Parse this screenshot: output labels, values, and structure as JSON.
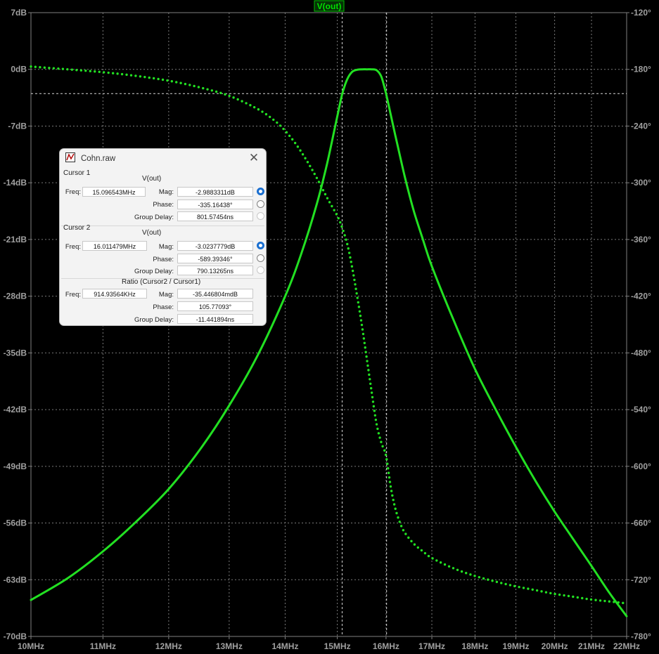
{
  "chart_data": {
    "type": "line",
    "title": "V(out)",
    "x_ticks": [
      "10MHz",
      "11MHz",
      "12MHz",
      "13MHz",
      "14MHz",
      "15MHz",
      "16MHz",
      "17MHz",
      "18MHz",
      "19MHz",
      "20MHz",
      "21MHz",
      "22MHz"
    ],
    "xlim": [
      10,
      22
    ],
    "x_scale": "log",
    "y_left_ticks": [
      "7dB",
      "0dB",
      "-7dB",
      "-14dB",
      "-21dB",
      "-28dB",
      "-35dB",
      "-42dB",
      "-49dB",
      "-56dB",
      "-63dB",
      "-70dB"
    ],
    "y_left_lim": [
      -70,
      7
    ],
    "y_right_ticks": [
      "-120°",
      "-180°",
      "-240°",
      "-300°",
      "-360°",
      "-420°",
      "-480°",
      "-540°",
      "-600°",
      "-660°",
      "-720°",
      "-780°"
    ],
    "y_right_lim": [
      -780,
      -120
    ],
    "grid": true,
    "cursor_x": [
      15.096543,
      16.011479
    ],
    "cursor_y_db": -2.99,
    "series": [
      {
        "name": "magnitude",
        "style": "solid",
        "axis": "left",
        "color": "#22e022",
        "x": [
          10.0,
          10.5,
          11.0,
          11.5,
          12.0,
          12.5,
          13.0,
          13.5,
          14.0,
          14.3,
          14.6,
          14.8,
          15.0,
          15.1,
          15.2,
          15.3,
          15.4,
          15.5,
          15.6,
          15.7,
          15.8,
          15.9,
          16.0,
          16.1,
          16.2,
          16.4,
          16.6,
          16.8,
          17.0,
          17.5,
          18.0,
          18.5,
          19.0,
          19.5,
          20.0,
          20.5,
          21.0,
          21.5,
          22.0
        ],
        "y": [
          -65.5,
          -62.8,
          -59.5,
          -55.8,
          -51.8,
          -47.0,
          -41.5,
          -35.3,
          -28.0,
          -22.8,
          -16.6,
          -11.6,
          -5.8,
          -3.0,
          -1.2,
          -0.3,
          -0.05,
          0.0,
          0.0,
          0.0,
          -0.1,
          -0.9,
          -3.0,
          -5.6,
          -8.2,
          -13.2,
          -17.5,
          -21.0,
          -24.3,
          -31.0,
          -37.0,
          -42.0,
          -46.6,
          -50.8,
          -54.6,
          -58.0,
          -61.3,
          -64.6,
          -67.5
        ]
      },
      {
        "name": "phase",
        "style": "dotted",
        "axis": "right",
        "color": "#22e022",
        "x": [
          10.0,
          10.5,
          11.0,
          11.5,
          12.0,
          12.5,
          13.0,
          13.5,
          13.8,
          14.0,
          14.2,
          14.4,
          14.6,
          14.8,
          15.0,
          15.1,
          15.2,
          15.3,
          15.4,
          15.5,
          15.6,
          15.7,
          15.8,
          15.9,
          16.0,
          16.1,
          16.2,
          16.3,
          16.4,
          16.6,
          16.8,
          17.0,
          17.5,
          18.0,
          18.5,
          19.0,
          19.5,
          20.0,
          20.5,
          21.0,
          21.5,
          22.0
        ],
        "y": [
          -177,
          -180,
          -183,
          -187,
          -192,
          -199,
          -208,
          -222,
          -234,
          -245,
          -259,
          -276,
          -295,
          -316,
          -335,
          -348,
          -365,
          -390,
          -420,
          -452,
          -487,
          -522,
          -555,
          -575,
          -589,
          -622,
          -645,
          -660,
          -670,
          -682,
          -690,
          -697,
          -708,
          -716,
          -722,
          -727,
          -731,
          -735,
          -738,
          -741,
          -743,
          -745
        ]
      }
    ]
  },
  "dialog": {
    "title": "Cohn.raw",
    "cursor1": {
      "section": "Cursor 1",
      "trace": "V(out)",
      "freq_label": "Freq:",
      "freq": "15.096543MHz",
      "mag_label": "Mag:",
      "mag": "-2.9883311dB",
      "phase_label": "Phase:",
      "phase": "-335.16438°",
      "gd_label": "Group Delay:",
      "gd": "801.57454ns"
    },
    "cursor2": {
      "section": "Cursor 2",
      "trace": "V(out)",
      "freq_label": "Freq:",
      "freq": "16.011479MHz",
      "mag_label": "Mag:",
      "mag": "-3.0237779dB",
      "phase_label": "Phase:",
      "phase": "-589.39346°",
      "gd_label": "Group Delay:",
      "gd": "790.13265ns"
    },
    "ratio": {
      "section": "Ratio (Cursor2 / Cursor1)",
      "freq_label": "Freq:",
      "freq": "914.93564KHz",
      "mag_label": "Mag:",
      "mag": "-35.446804mdB",
      "phase_label": "Phase:",
      "phase": "105.77093°",
      "gd_label": "Group Delay:",
      "gd": "-11.441894ns"
    },
    "icons": {
      "app": "waveform-app-icon",
      "close": "close-icon"
    }
  }
}
